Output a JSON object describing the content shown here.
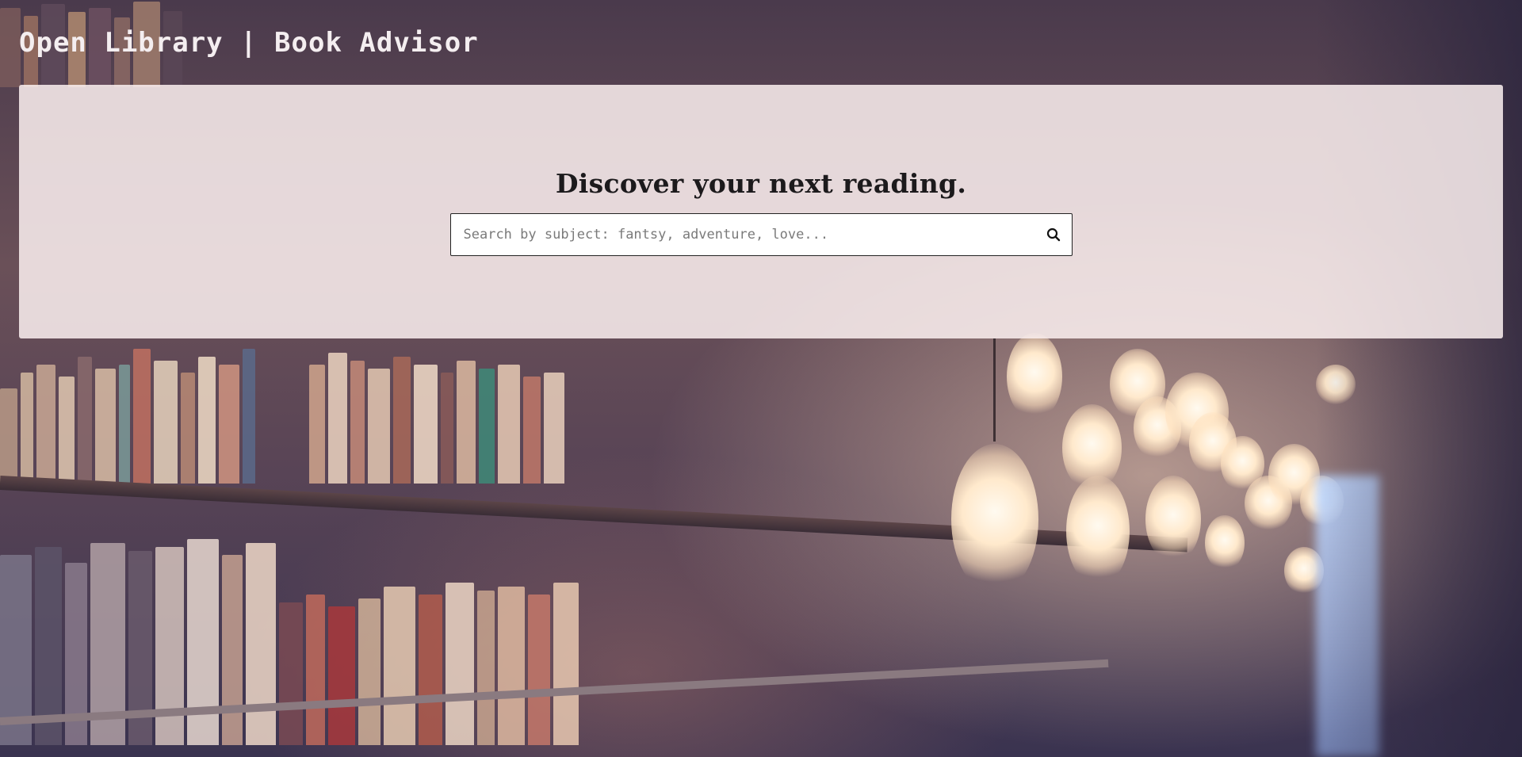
{
  "header": {
    "title": "Open Library | Book Advisor"
  },
  "hero": {
    "heading": "Discover your next reading.",
    "search": {
      "placeholder": "Search by subject: fantsy, adventure, love...",
      "value": "",
      "button_icon": "search-icon"
    }
  },
  "colors": {
    "panel_background": "#fcf0f0",
    "title_text": "#f4eef0",
    "heading_text": "#1c1a1c"
  }
}
